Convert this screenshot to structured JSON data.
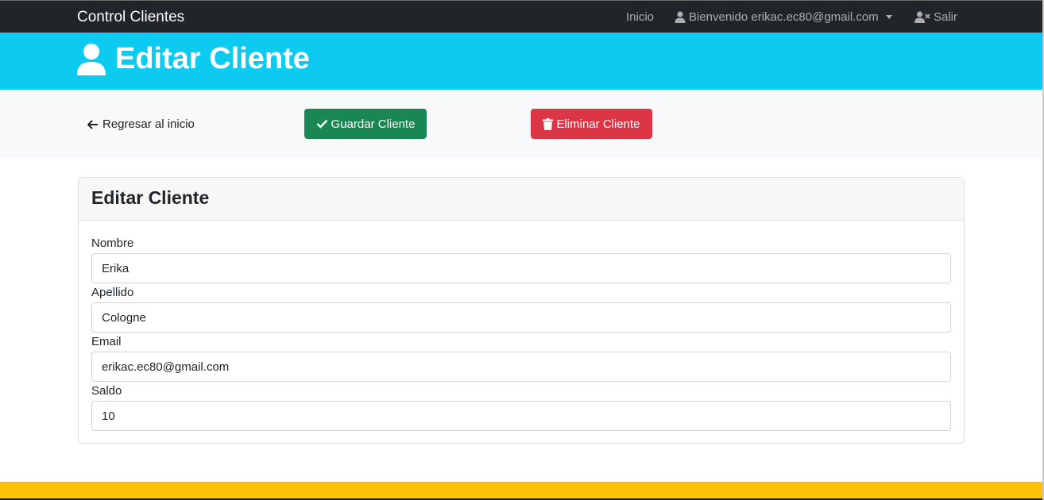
{
  "navbar": {
    "brand": "Control Clientes",
    "inicio": "Inicio",
    "user_label": "Bienvenido erikac.ec80@gmail.com",
    "salir": "Salir"
  },
  "header": {
    "title": "Editar Cliente",
    "icon": "user-icon"
  },
  "actions": {
    "back_label": "Regresar al inicio",
    "save_label": "Guardar Cliente",
    "delete_label": "Eliminar Cliente"
  },
  "card": {
    "title": "Editar Cliente",
    "fields": [
      {
        "label": "Nombre",
        "value": "Erika"
      },
      {
        "label": "Apellido",
        "value": "Cologne"
      },
      {
        "label": "Email",
        "value": "erikac.ec80@gmail.com"
      },
      {
        "label": "Saldo",
        "value": "10"
      }
    ]
  },
  "colors": {
    "navbar": "#212529",
    "header": "#0dcaf0",
    "save": "#198754",
    "delete": "#dc3545",
    "footer": "#ffc107"
  }
}
